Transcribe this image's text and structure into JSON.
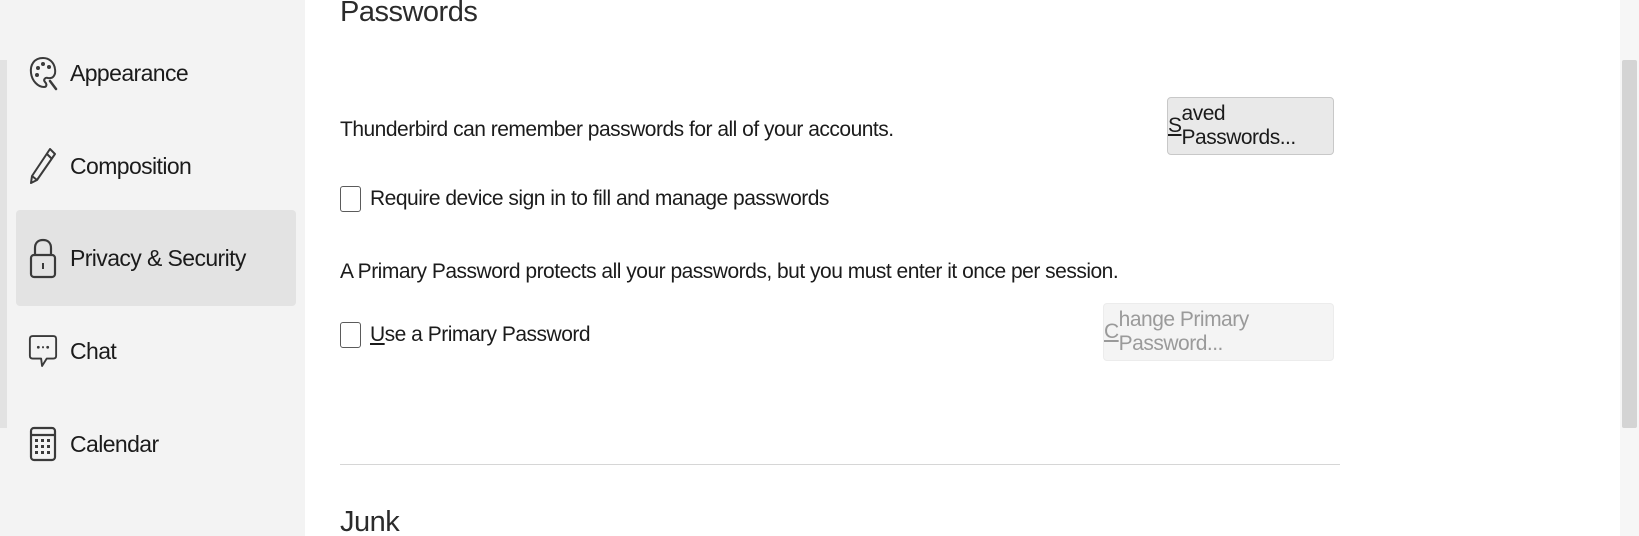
{
  "sidebar": {
    "items": [
      {
        "label": "Appearance",
        "icon": "palette-icon"
      },
      {
        "label": "Composition",
        "icon": "pencil-icon"
      },
      {
        "label": "Privacy & Security",
        "icon": "lock-icon",
        "selected": true
      },
      {
        "label": "Chat",
        "icon": "chat-bubble-icon"
      },
      {
        "label": "Calendar",
        "icon": "calendar-icon"
      }
    ]
  },
  "passwords": {
    "heading": "Passwords",
    "remember_text": "Thunderbird can remember passwords for all of your accounts.",
    "saved_passwords_button": {
      "prefix": "S",
      "rest": "aved Passwords..."
    },
    "require_signin_label": "Require device sign in to fill and manage passwords",
    "require_signin_checked": false,
    "primary_password_text": "A Primary Password protects all your passwords, but you must enter it once per session.",
    "use_primary_label": {
      "prefix": "U",
      "rest": "se a Primary Password"
    },
    "use_primary_checked": false,
    "change_primary_button": {
      "prefix": "C",
      "rest": "hange Primary Password..."
    },
    "change_primary_enabled": false
  },
  "junk": {
    "heading": "Junk"
  },
  "colors": {
    "sidebar_bg": "#f3f3f3",
    "sidebar_selected_bg": "#e3e3e3",
    "button_bg": "#e9e9e9",
    "disabled_text": "#9a9a9a"
  }
}
